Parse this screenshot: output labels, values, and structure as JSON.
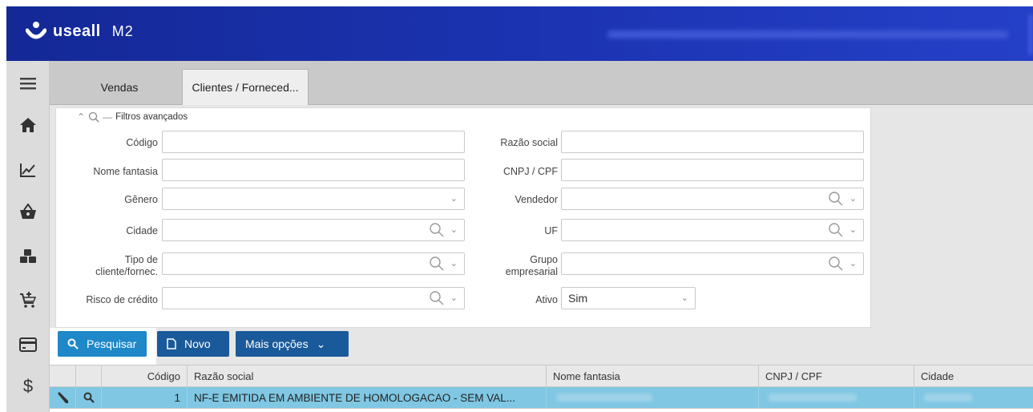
{
  "app": {
    "logo_text": "useall",
    "logo_sub": "M2"
  },
  "tabs": [
    {
      "label": "Vendas"
    },
    {
      "label": "Clientes / Forneced..."
    }
  ],
  "filters": {
    "title": "Filtros avançados",
    "fields": {
      "codigo": {
        "label": "Código",
        "value": ""
      },
      "razao_social": {
        "label": "Razão social",
        "value": ""
      },
      "nome_fantasia": {
        "label": "Nome fantasia",
        "value": ""
      },
      "cnpj_cpf": {
        "label": "CNPJ / CPF",
        "value": ""
      },
      "genero": {
        "label": "Gênero",
        "value": ""
      },
      "vendedor": {
        "label": "Vendedor",
        "value": ""
      },
      "cidade": {
        "label": "Cidade",
        "value": ""
      },
      "uf": {
        "label": "UF",
        "value": ""
      },
      "tipo_cliente_1": "Tipo de",
      "tipo_cliente_2": "cliente/fornec.",
      "grupo_1": "Grupo",
      "grupo_2": "empresarial",
      "risco_credito": {
        "label": "Risco de crédito",
        "value": ""
      },
      "ativo": {
        "label": "Ativo",
        "value": "Sim"
      }
    }
  },
  "buttons": {
    "pesquisar": "Pesquisar",
    "novo": "Novo",
    "mais_opcoes": "Mais opções"
  },
  "table": {
    "columns": [
      "Código",
      "Razão social",
      "Nome fantasia",
      "CNPJ / CPF",
      "Cidade"
    ],
    "rows": [
      {
        "codigo": "1",
        "razao_social": "NF-E EMITIDA EM AMBIENTE DE HOMOLOGACAO - SEM VAL..."
      }
    ]
  },
  "colors": {
    "header_blue": "#1c34b3",
    "pesquisar_button": "#1e88c8",
    "secondary_button": "#1a5a9a",
    "selected_row": "#7fc7e3"
  }
}
